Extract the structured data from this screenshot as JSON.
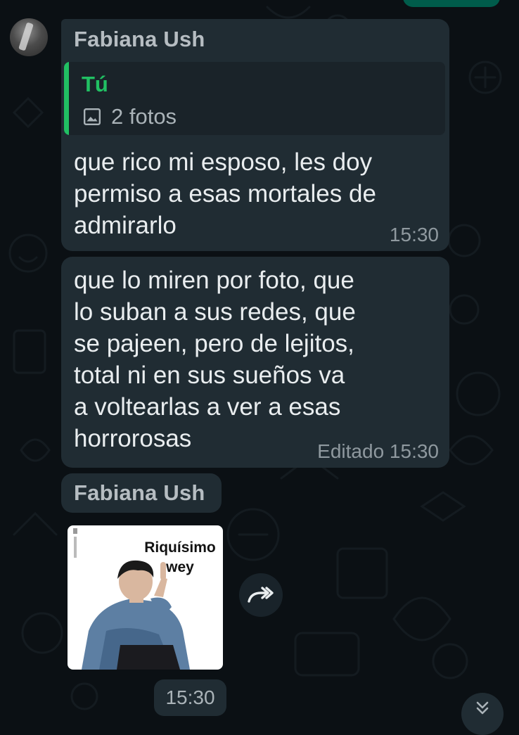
{
  "colors": {
    "background": "#0b1014",
    "bubble": "#202c33",
    "accent_green": "#21c063",
    "text": "#e9edef",
    "meta": "#8f999f"
  },
  "messages": [
    {
      "sender": "Fabiana Ush",
      "quote": {
        "author": "Tú",
        "icon": "photo-icon",
        "text": "2 fotos"
      },
      "text": "que rico mi esposo, les doy\npermiso a esas mortales de\nadmirarlo",
      "time": "15:30"
    },
    {
      "text": "que lo miren por foto, que\nlo suban a sus redes, que\nse pajeen, pero de lejitos,\ntotal ni en sus sueños va\na voltearlas a ver a esas\nhorrorosas",
      "edited_label": "Editado",
      "time": "15:30"
    }
  ],
  "sticker_message": {
    "sender": "Fabiana Ush",
    "caption": "Riquísimo\nwey",
    "forward_icon": "forward-icon",
    "time": "15:30"
  },
  "scroll_down_icon": "double-chevron-down-icon"
}
